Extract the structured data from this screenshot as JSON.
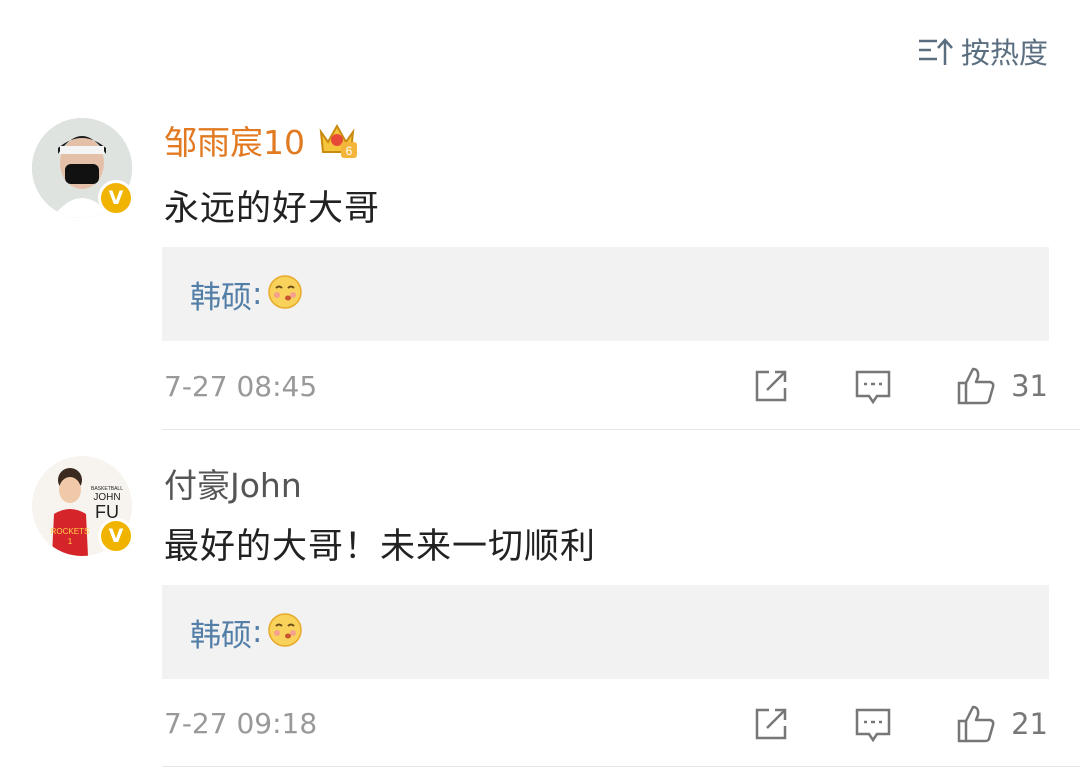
{
  "sort": {
    "label": "按热度",
    "icon": "sort-hot-icon"
  },
  "comments": [
    {
      "user": "邹雨宸10",
      "text": "永远的好大哥",
      "reply": {
        "name": "韩硕",
        "colon": ":"
      },
      "time": "7-27 08:45",
      "likes": "31",
      "vip_badge_level": "6"
    },
    {
      "user": "付豪John",
      "text": "最好的大哥！未来一切顺利",
      "reply": {
        "name": "韩硕",
        "colon": ":"
      },
      "time": "7-27 09:18",
      "likes": "21",
      "avatar_text": [
        "BASKETBALL",
        "JOHN",
        "FU",
        "ROCKETS",
        "1"
      ]
    }
  ],
  "colors": {
    "vip_name": "#e27a22",
    "reply_name": "#527ea8",
    "badge": "#f0b400",
    "reply_bg": "#f2f2f2"
  }
}
